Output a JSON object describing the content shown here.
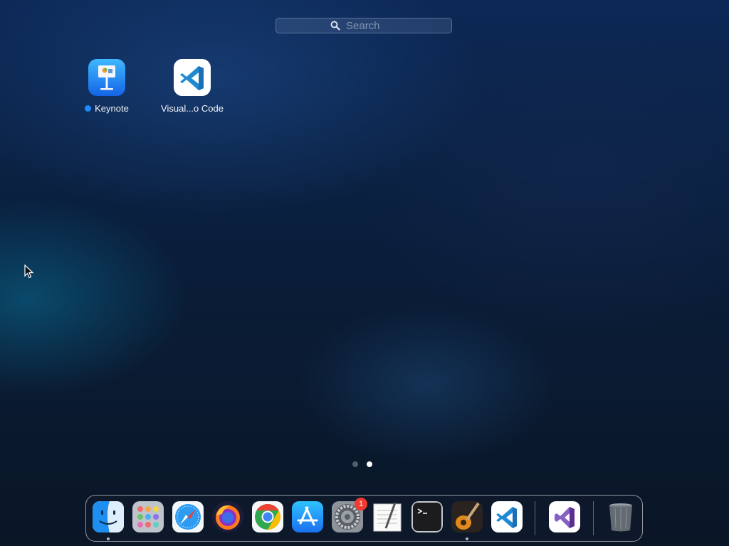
{
  "search": {
    "placeholder": "Search",
    "icon": "magnifying-glass-icon"
  },
  "apps": [
    {
      "name": "Keynote",
      "icon": "keynote-icon",
      "new_indicator": true,
      "indicator_color": "#1e8cff"
    },
    {
      "name": "Visual...o Code",
      "icon": "vscode-icon",
      "new_indicator": false
    }
  ],
  "page_indicator": {
    "pages": 2,
    "current": 2
  },
  "dock": {
    "items": [
      {
        "name": "Finder",
        "icon": "finder-icon",
        "running": true
      },
      {
        "name": "Launchpad",
        "icon": "launchpad-icon",
        "running": false
      },
      {
        "name": "Safari",
        "icon": "safari-icon",
        "running": false
      },
      {
        "name": "Firefox",
        "icon": "firefox-icon",
        "running": false
      },
      {
        "name": "Google Chrome",
        "icon": "chrome-icon",
        "running": false
      },
      {
        "name": "App Store",
        "icon": "app-store-icon",
        "running": false
      },
      {
        "name": "System Preferences",
        "icon": "system-preferences-icon",
        "running": false,
        "badge": "1"
      },
      {
        "name": "TextEdit",
        "icon": "textedit-icon",
        "running": false
      },
      {
        "name": "Terminal",
        "icon": "terminal-icon",
        "running": false
      },
      {
        "name": "GarageBand",
        "icon": "garageband-icon",
        "running": true
      },
      {
        "name": "Visual Studio Code",
        "icon": "vscode-icon",
        "running": false
      },
      {
        "name": "Visual Studio",
        "icon": "visual-studio-icon",
        "running": false
      },
      {
        "name": "Trash",
        "icon": "trash-icon",
        "running": false
      }
    ]
  },
  "colors": {
    "badge": "#f23b30",
    "accent": "#1e8cff",
    "vscode_blue": "#1f8ad2",
    "visual_studio_purple": "#8661c5"
  }
}
